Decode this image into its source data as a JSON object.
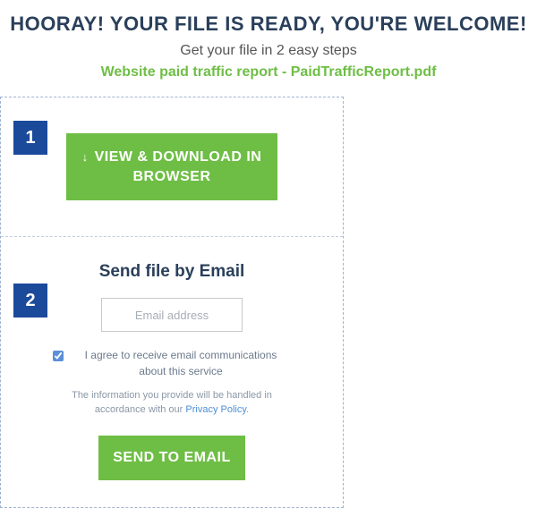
{
  "header": {
    "title": "HOORAY! YOUR FILE IS READY, YOU'RE WELCOME!",
    "subtitle": "Get your file in 2 easy steps",
    "filename": "Website paid traffic report - PaidTrafficReport.pdf"
  },
  "step1": {
    "number": "1",
    "download_label": "VIEW & DOWNLOAD IN BROWSER"
  },
  "step2": {
    "number": "2",
    "heading": "Send file by Email",
    "email_placeholder": "Email address",
    "consent_text": "I agree to receive email communications about this service",
    "disclaimer_pre": "The information you provide will be handled in accordance with our ",
    "privacy_link": "Privacy Policy",
    "disclaimer_post": ".",
    "send_label": "SEND TO EMAIL"
  }
}
